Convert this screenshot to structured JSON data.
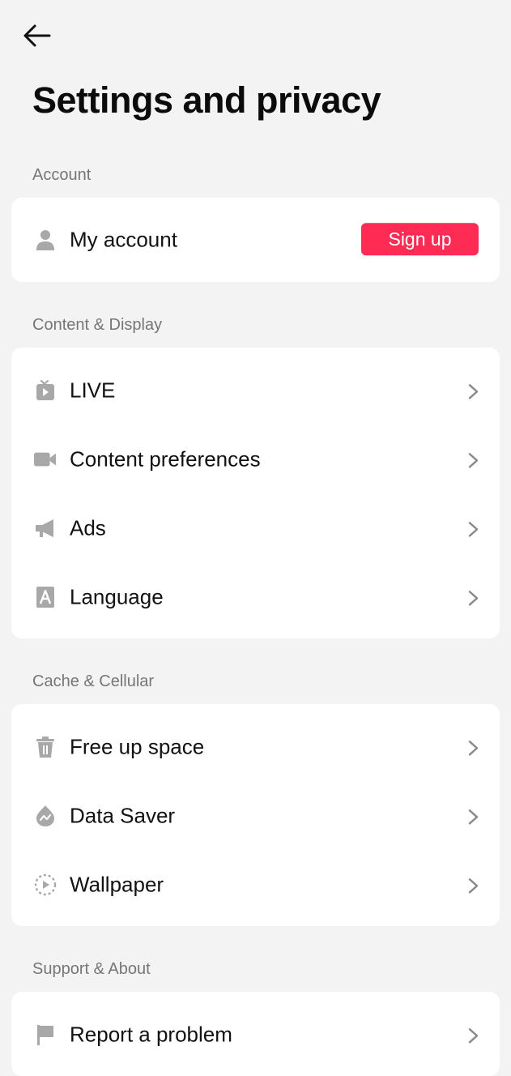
{
  "header": {
    "back_icon": "arrow-left-icon",
    "title": "Settings and privacy"
  },
  "sections": [
    {
      "label": "Account",
      "items": [
        {
          "icon": "person-icon",
          "label": "My account",
          "action_label": "Sign up",
          "action_color": "#fe2c55"
        }
      ]
    },
    {
      "label": "Content & Display",
      "items": [
        {
          "icon": "live-tv-icon",
          "label": "LIVE"
        },
        {
          "icon": "video-camera-icon",
          "label": "Content preferences"
        },
        {
          "icon": "megaphone-icon",
          "label": "Ads"
        },
        {
          "icon": "language-icon",
          "label": "Language"
        }
      ]
    },
    {
      "label": "Cache & Cellular",
      "items": [
        {
          "icon": "trash-icon",
          "label": "Free up space"
        },
        {
          "icon": "data-saver-icon",
          "label": "Data Saver"
        },
        {
          "icon": "wallpaper-icon",
          "label": "Wallpaper"
        }
      ]
    },
    {
      "label": "Support & About",
      "items": [
        {
          "icon": "flag-icon",
          "label": "Report a problem"
        }
      ]
    }
  ],
  "colors": {
    "background": "#f3f3f3",
    "card": "#ffffff",
    "accent": "#fe2c55",
    "section_label": "#767676",
    "icon": "#a8a8a8"
  }
}
